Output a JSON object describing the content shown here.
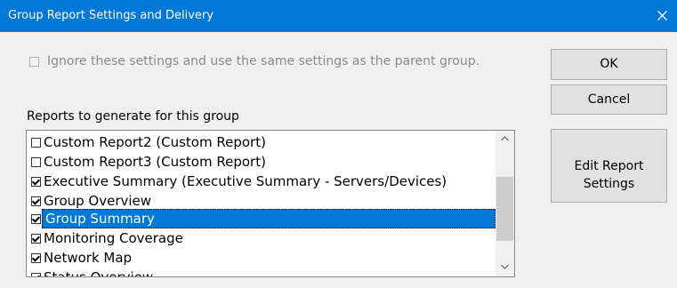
{
  "dialog": {
    "title": "Group Report Settings and Delivery",
    "close_icon": "close-icon"
  },
  "inherit": {
    "label": "Ignore these settings and use the same settings as the parent group.",
    "checked": false,
    "enabled": false
  },
  "reports": {
    "label": "Reports to generate for this group",
    "items": [
      {
        "label": "Custom Report2 (Custom Report)",
        "checked": false,
        "selected": false
      },
      {
        "label": "Custom Report3 (Custom Report)",
        "checked": false,
        "selected": false
      },
      {
        "label": "Executive Summary (Executive Summary - Servers/Devices)",
        "checked": true,
        "selected": false
      },
      {
        "label": "Group Overview",
        "checked": true,
        "selected": false
      },
      {
        "label": "Group Summary",
        "checked": true,
        "selected": true
      },
      {
        "label": "Monitoring Coverage",
        "checked": true,
        "selected": false
      },
      {
        "label": "Network Map",
        "checked": true,
        "selected": false
      },
      {
        "label": "Status Overview",
        "checked": true,
        "selected": false
      }
    ],
    "scroll_up_icon": "chevron-up-icon",
    "scroll_down_icon": "chevron-down-icon"
  },
  "buttons": {
    "ok": "OK",
    "cancel": "Cancel",
    "edit_report_settings": "Edit Report Settings"
  },
  "colors": {
    "titlebar": "#0078d7",
    "selection": "#0078d7",
    "window": "#f0f0f0"
  }
}
